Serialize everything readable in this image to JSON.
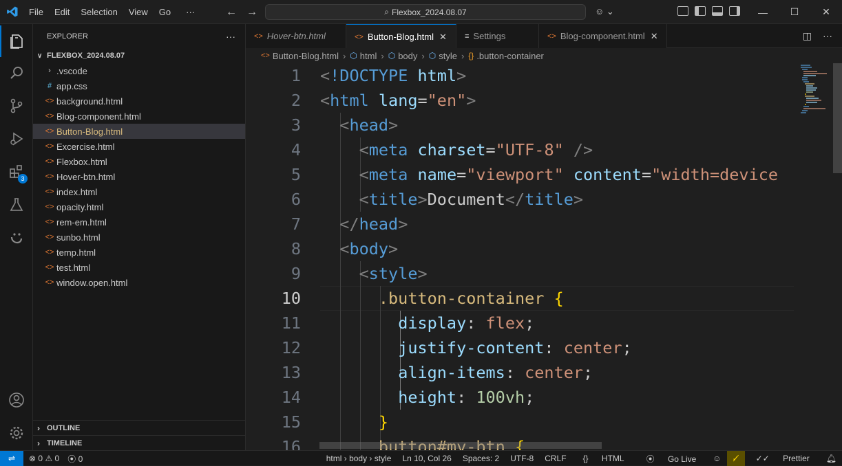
{
  "titlebar": {
    "menu": [
      "File",
      "Edit",
      "Selection",
      "View",
      "Go",
      "···"
    ],
    "search_text": "Flexbox_2024.08.07"
  },
  "activity": {
    "extensions_badge": "3"
  },
  "explorer": {
    "header": "EXPLORER",
    "more": "···",
    "folder": "FLEXBOX_2024.08.07",
    "files": [
      {
        "name": ".vscode",
        "kind": "folder"
      },
      {
        "name": "app.css",
        "kind": "css"
      },
      {
        "name": "background.html",
        "kind": "html"
      },
      {
        "name": "Blog-component.html",
        "kind": "html"
      },
      {
        "name": "Button-Blog.html",
        "kind": "html"
      },
      {
        "name": "Excercise.html",
        "kind": "html"
      },
      {
        "name": "Flexbox.html",
        "kind": "html"
      },
      {
        "name": "Hover-btn.html",
        "kind": "html"
      },
      {
        "name": "index.html",
        "kind": "html"
      },
      {
        "name": "opacity.html",
        "kind": "html"
      },
      {
        "name": "rem-em.html",
        "kind": "html"
      },
      {
        "name": "sunbo.html",
        "kind": "html"
      },
      {
        "name": "temp.html",
        "kind": "html"
      },
      {
        "name": "test.html",
        "kind": "html"
      },
      {
        "name": "window.open.html",
        "kind": "html"
      }
    ],
    "outline": "OUTLINE",
    "timeline": "TIMELINE"
  },
  "tabs": [
    {
      "label": "Hover-btn.html",
      "icon": "<>"
    },
    {
      "label": "Button-Blog.html",
      "icon": "<>"
    },
    {
      "label": "Settings",
      "icon": "≡"
    },
    {
      "label": "Blog-component.html",
      "icon": "<>"
    }
  ],
  "breadcrumb": [
    "Button-Blog.html",
    "html",
    "body",
    "style",
    ".button-container"
  ],
  "editor": {
    "line_numbers": [
      "1",
      "2",
      "3",
      "4",
      "5",
      "6",
      "7",
      "8",
      "9",
      "10",
      "11",
      "12",
      "13",
      "14",
      "15",
      "16"
    ],
    "current_line": "10"
  },
  "status": {
    "errors": "0",
    "warnings": "0",
    "ports": "0",
    "path": "html › body › style",
    "position": "Ln 10, Col 26",
    "spaces": "Spaces: 2",
    "encoding": "UTF-8",
    "eol": "CRLF",
    "language": "HTML",
    "golive": "Go Live",
    "prettier": "Prettier"
  }
}
